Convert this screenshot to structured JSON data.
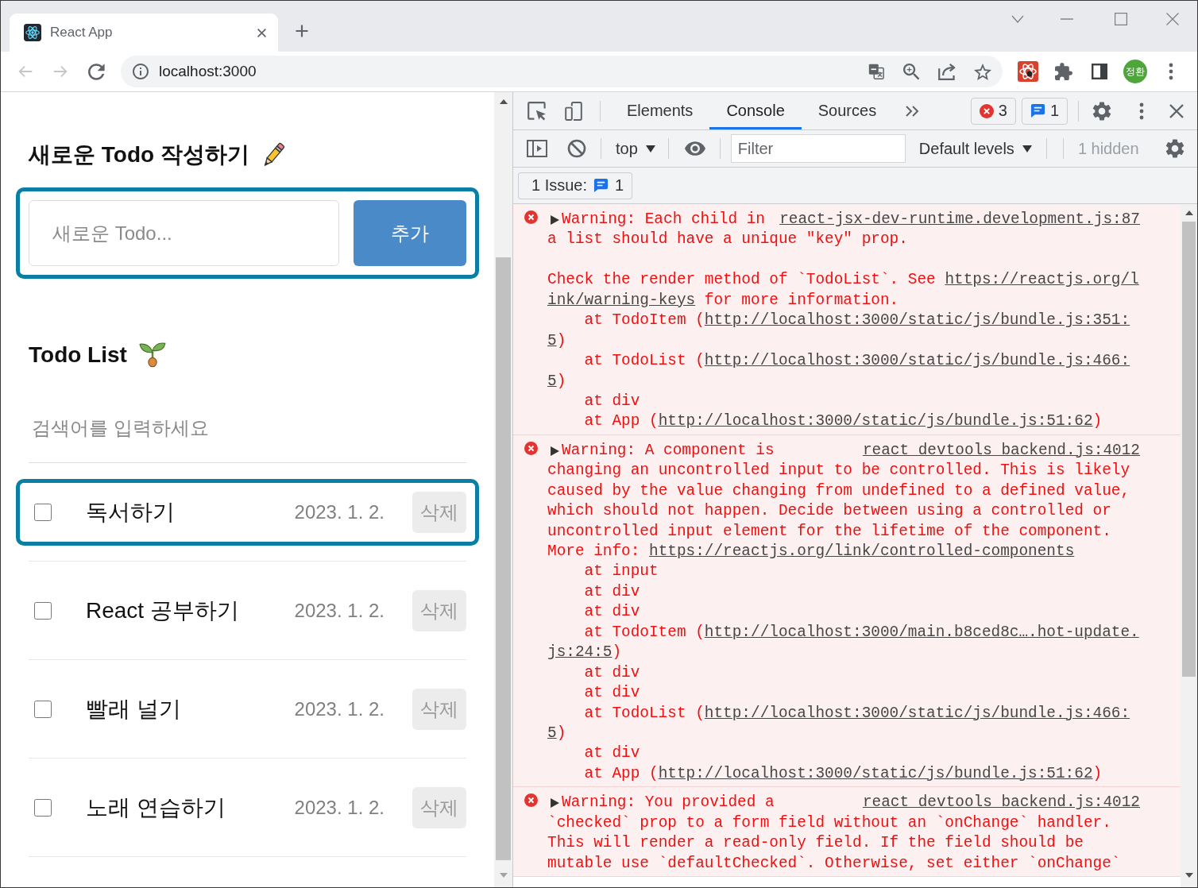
{
  "browser": {
    "tabs": [
      {
        "title": "React App",
        "selected": true
      }
    ],
    "address": "localhost:3000",
    "profile": "정환"
  },
  "todo_app": {
    "editor": {
      "title": "새로운 Todo 작성하기",
      "placeholder": "새로운 Todo...",
      "button": "추가",
      "highlighted": true
    },
    "list": {
      "title": "Todo List",
      "search_placeholder": "검색어를 입력하세요",
      "items": [
        {
          "content": "독서하기",
          "checked": false,
          "date": "2023. 1. 2.",
          "button": "삭제",
          "highlighted": true
        },
        {
          "content": "React 공부하기",
          "checked": false,
          "date": "2023. 1. 2.",
          "button": "삭제",
          "highlighted": false
        },
        {
          "content": "빨래 널기",
          "checked": false,
          "date": "2023. 1. 2.",
          "button": "삭제",
          "highlighted": false
        },
        {
          "content": "노래 연습하기",
          "checked": false,
          "date": "2023. 1. 2.",
          "button": "삭제",
          "highlighted": false
        }
      ]
    }
  },
  "devtools": {
    "tabs": [
      {
        "label": "Elements",
        "selected": false
      },
      {
        "label": "Console",
        "selected": true
      },
      {
        "label": "Sources",
        "selected": false
      }
    ],
    "error_count": "3",
    "message_count": "1",
    "toolbar": {
      "context": "top",
      "filter_placeholder": "Filter",
      "levels": "Default levels",
      "hidden": "1 hidden"
    },
    "issues": {
      "label": "1 Issue:",
      "count": "1"
    },
    "messages": [
      {
        "kind": "error",
        "source": "react-jsx-dev-runtime.development.js:87",
        "lines": [
          {
            "kind": "head",
            "parts": [
              {
                "kind": "text",
                "text": "Warning: Each child in"
              }
            ]
          },
          {
            "kind": "text",
            "parts": [
              {
                "kind": "text",
                "text": "a list should have a unique \"key\" prop."
              }
            ]
          },
          {
            "kind": "gap"
          },
          {
            "kind": "text",
            "parts": [
              {
                "kind": "text",
                "text": "Check the render method of `TodoList`. See "
              },
              {
                "kind": "link",
                "text": "https://reactjs.org/l"
              }
            ]
          },
          {
            "kind": "text",
            "parts": [
              {
                "kind": "link",
                "text": "ink/warning-keys"
              },
              {
                "kind": "text",
                "text": " for more information."
              }
            ]
          },
          {
            "kind": "frame",
            "parts": [
              {
                "kind": "text",
                "text": "at TodoItem ("
              },
              {
                "kind": "link",
                "text": "http://localhost:3000/static/js/bundle.js:351:"
              }
            ]
          },
          {
            "kind": "text",
            "parts": [
              {
                "kind": "link",
                "text": "5"
              },
              {
                "kind": "text",
                "text": ")"
              }
            ]
          },
          {
            "kind": "frame",
            "parts": [
              {
                "kind": "text",
                "text": "at TodoList ("
              },
              {
                "kind": "link",
                "text": "http://localhost:3000/static/js/bundle.js:466:"
              }
            ]
          },
          {
            "kind": "text",
            "parts": [
              {
                "kind": "link",
                "text": "5"
              },
              {
                "kind": "text",
                "text": ")"
              }
            ]
          },
          {
            "kind": "frame",
            "parts": [
              {
                "kind": "text",
                "text": "at div"
              }
            ]
          },
          {
            "kind": "frame",
            "parts": [
              {
                "kind": "text",
                "text": "at App ("
              },
              {
                "kind": "link",
                "text": "http://localhost:3000/static/js/bundle.js:51:62"
              },
              {
                "kind": "text",
                "text": ")"
              }
            ]
          }
        ]
      },
      {
        "kind": "error",
        "source": "react_devtools_backend.js:4012",
        "lines": [
          {
            "kind": "head",
            "parts": [
              {
                "kind": "text",
                "text": "Warning: A component is"
              }
            ]
          },
          {
            "kind": "text",
            "parts": [
              {
                "kind": "text",
                "text": "changing an uncontrolled input to be controlled. This is likely"
              }
            ]
          },
          {
            "kind": "text",
            "parts": [
              {
                "kind": "text",
                "text": "caused by the value changing from undefined to a defined value,"
              }
            ]
          },
          {
            "kind": "text",
            "parts": [
              {
                "kind": "text",
                "text": "which should not happen. Decide between using a controlled or"
              }
            ]
          },
          {
            "kind": "text",
            "parts": [
              {
                "kind": "text",
                "text": "uncontrolled input element for the lifetime of the component."
              }
            ]
          },
          {
            "kind": "text",
            "parts": [
              {
                "kind": "text",
                "text": "More info: "
              },
              {
                "kind": "link",
                "text": "https://reactjs.org/link/controlled-components"
              }
            ]
          },
          {
            "kind": "frame",
            "parts": [
              {
                "kind": "text",
                "text": "at input"
              }
            ]
          },
          {
            "kind": "frame",
            "parts": [
              {
                "kind": "text",
                "text": "at div"
              }
            ]
          },
          {
            "kind": "frame",
            "parts": [
              {
                "kind": "text",
                "text": "at div"
              }
            ]
          },
          {
            "kind": "frame",
            "parts": [
              {
                "kind": "text",
                "text": "at TodoItem ("
              },
              {
                "kind": "link",
                "text": "http://localhost:3000/main.b8ced8c….hot-update."
              }
            ]
          },
          {
            "kind": "text",
            "parts": [
              {
                "kind": "link",
                "text": "js:24:5"
              },
              {
                "kind": "text",
                "text": ")"
              }
            ]
          },
          {
            "kind": "frame",
            "parts": [
              {
                "kind": "text",
                "text": "at div"
              }
            ]
          },
          {
            "kind": "frame",
            "parts": [
              {
                "kind": "text",
                "text": "at div"
              }
            ]
          },
          {
            "kind": "frame",
            "parts": [
              {
                "kind": "text",
                "text": "at TodoList ("
              },
              {
                "kind": "link",
                "text": "http://localhost:3000/static/js/bundle.js:466:"
              }
            ]
          },
          {
            "kind": "text",
            "parts": [
              {
                "kind": "link",
                "text": "5"
              },
              {
                "kind": "text",
                "text": ")"
              }
            ]
          },
          {
            "kind": "frame",
            "parts": [
              {
                "kind": "text",
                "text": "at div"
              }
            ]
          },
          {
            "kind": "frame",
            "parts": [
              {
                "kind": "text",
                "text": "at App ("
              },
              {
                "kind": "link",
                "text": "http://localhost:3000/static/js/bundle.js:51:62"
              },
              {
                "kind": "text",
                "text": ")"
              }
            ]
          }
        ]
      },
      {
        "kind": "error",
        "source": "react_devtools_backend.js:4012",
        "lines": [
          {
            "kind": "head",
            "parts": [
              {
                "kind": "text",
                "text": "Warning: You provided a"
              }
            ]
          },
          {
            "kind": "text",
            "parts": [
              {
                "kind": "text",
                "text": "`checked` prop to a form field without an `onChange` handler."
              }
            ]
          },
          {
            "kind": "text",
            "parts": [
              {
                "kind": "text",
                "text": "This will render a read-only field. If the field should be"
              }
            ]
          },
          {
            "kind": "text",
            "parts": [
              {
                "kind": "text",
                "text": "mutable use `defaultChecked`. Otherwise, set either `onChange`"
              }
            ]
          }
        ]
      }
    ]
  }
}
